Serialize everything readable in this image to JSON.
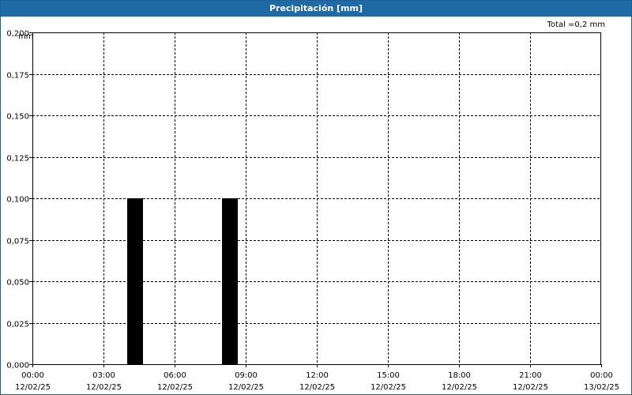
{
  "window": {
    "title": "Precipitación [mm]"
  },
  "total_text": "Total =0,2 mm",
  "colors": {
    "title_bar": "#1f6aa5",
    "bar": "#000000",
    "grid": "#000000"
  },
  "chart_data": {
    "type": "bar",
    "title": "Precipitación [mm]",
    "ylabel": "mm",
    "xlabel": "",
    "ylim": [
      0,
      0.2
    ],
    "yticks": [
      "0,000",
      "0,025",
      "0,050",
      "0,075",
      "0,100",
      "0,125",
      "0,150",
      "0,175",
      "0,200"
    ],
    "xticks": [
      {
        "time": "00:00",
        "date": "12/02/25"
      },
      {
        "time": "03:00",
        "date": "12/02/25"
      },
      {
        "time": "06:00",
        "date": "12/02/25"
      },
      {
        "time": "09:00",
        "date": "12/02/25"
      },
      {
        "time": "12:00",
        "date": "12/02/25"
      },
      {
        "time": "15:00",
        "date": "12/02/25"
      },
      {
        "time": "18:00",
        "date": "12/02/25"
      },
      {
        "time": "21:00",
        "date": "12/02/25"
      },
      {
        "time": "00:00",
        "date": "13/02/25"
      }
    ],
    "xlim": [
      "12/02/25 00:00",
      "13/02/25 00:00"
    ],
    "bars": [
      {
        "start": "12/02/25 04:00",
        "end": "12/02/25 04:40",
        "value": 0.1
      },
      {
        "start": "12/02/25 08:00",
        "end": "12/02/25 08:40",
        "value": 0.1
      }
    ],
    "grid": true,
    "total": "Total =0,2 mm"
  }
}
